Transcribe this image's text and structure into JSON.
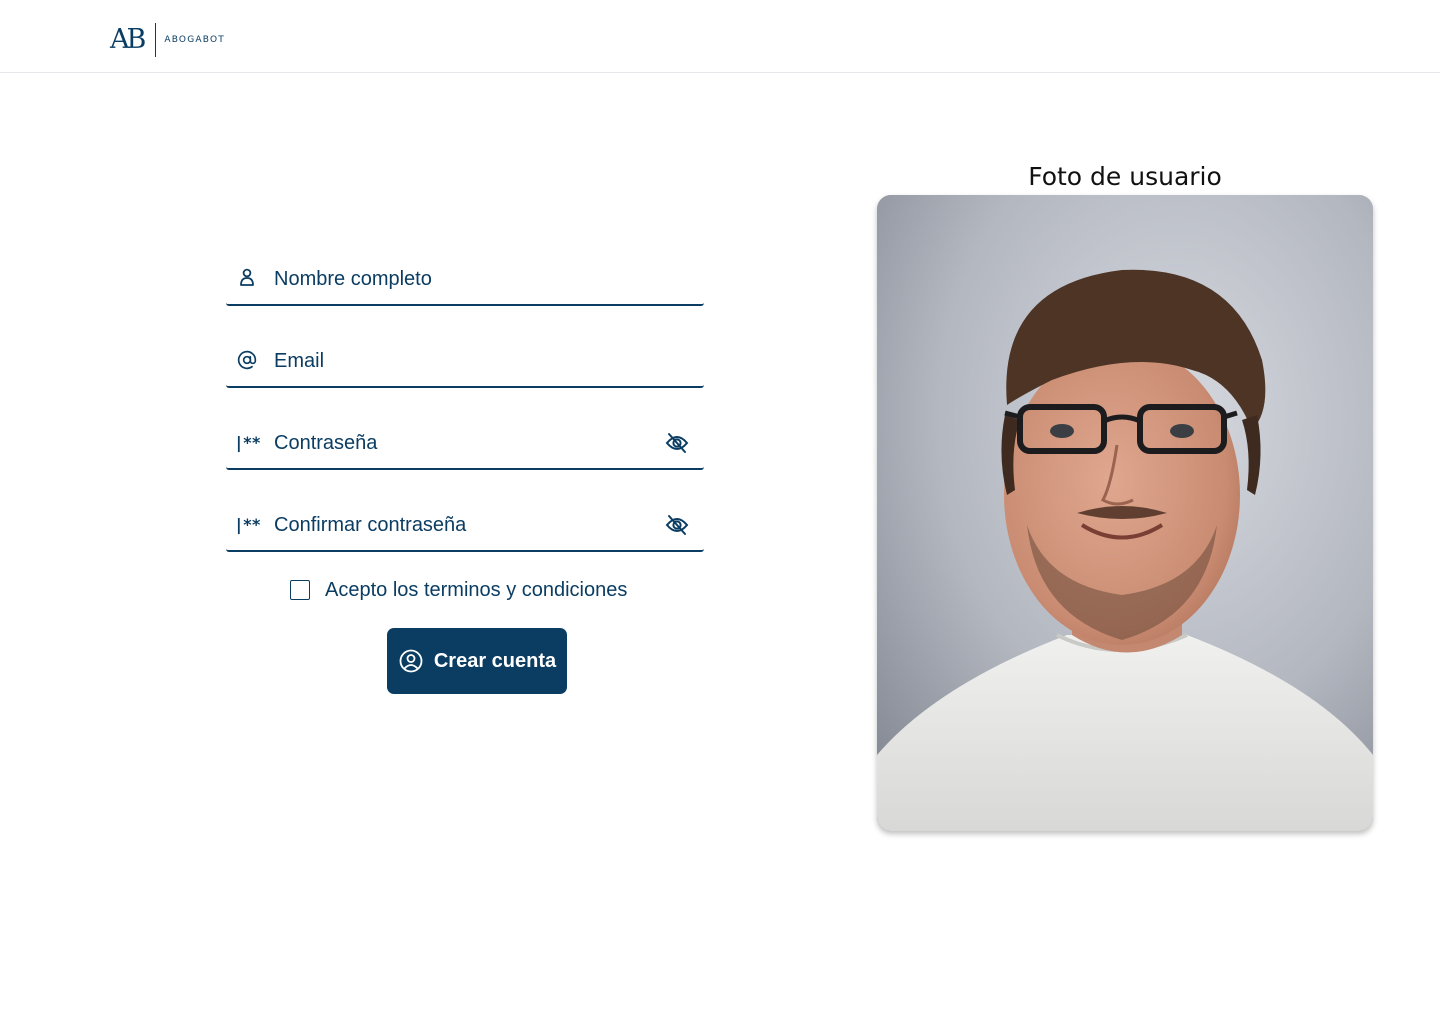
{
  "app": {
    "logo_mark": "AB",
    "logo_text": "ABOGABOT"
  },
  "form": {
    "name_placeholder": "Nombre completo",
    "email_placeholder": "Email",
    "password_placeholder": "Contraseña",
    "confirm_placeholder": "Confirmar contraseña",
    "password_icon_text": "|**",
    "terms_label": "Acepto los terminos y condiciones",
    "terms_checked": false,
    "submit_label": "Crear cuenta"
  },
  "photo": {
    "title": "Foto de usuario"
  },
  "icons": {
    "name_field": "person-icon",
    "email_field": "at-sign-icon",
    "password_field": "password-icon",
    "toggle_visibility": "eye-off-icon",
    "submit": "user-circle-icon"
  },
  "colors": {
    "primary": "#0b3d63",
    "background": "#ffffff",
    "title_text": "#111111"
  }
}
